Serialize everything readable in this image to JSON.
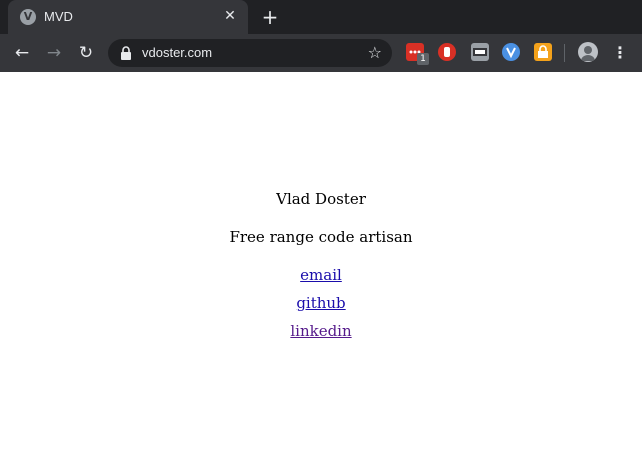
{
  "browser": {
    "tab": {
      "title": "MVD",
      "favicon_letter": "V"
    },
    "new_tab_label": "+",
    "url": "vdoster.com",
    "extension_badge": "1",
    "icons": [
      "back-arrow-icon",
      "forward-arrow-icon",
      "reload-icon",
      "lock-icon",
      "star-icon",
      "extension-icon",
      "user-avatar-icon",
      "menu-icon"
    ]
  },
  "page": {
    "name": "Vlad Doster",
    "tagline": "Free range code artisan",
    "links": [
      "email",
      "github",
      "linkedin"
    ]
  },
  "colors": {
    "link": "#1a0dab",
    "visited": "#551a8b",
    "chrome_dark": "#202124",
    "toolbar": "#35363a"
  }
}
